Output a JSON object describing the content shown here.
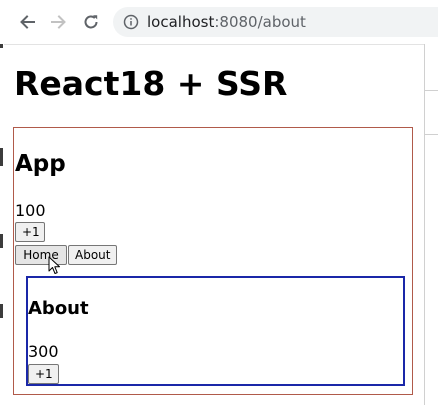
{
  "browser": {
    "url_host": "localhost",
    "url_port_path": ":8080/about",
    "icons": {
      "back": "arrow-left-icon",
      "forward": "arrow-right-icon",
      "reload": "reload-icon",
      "site_info": "info-icon"
    }
  },
  "page": {
    "title": "React18 + SSR",
    "app": {
      "heading": "App",
      "count": "100",
      "increment_label": "+1",
      "nav": {
        "home_label": "Home",
        "about_label": "About"
      },
      "border_color": "#b05a4a"
    },
    "about": {
      "heading": "About",
      "count": "300",
      "increment_label": "+1",
      "border_color": "#1a27a8"
    }
  }
}
